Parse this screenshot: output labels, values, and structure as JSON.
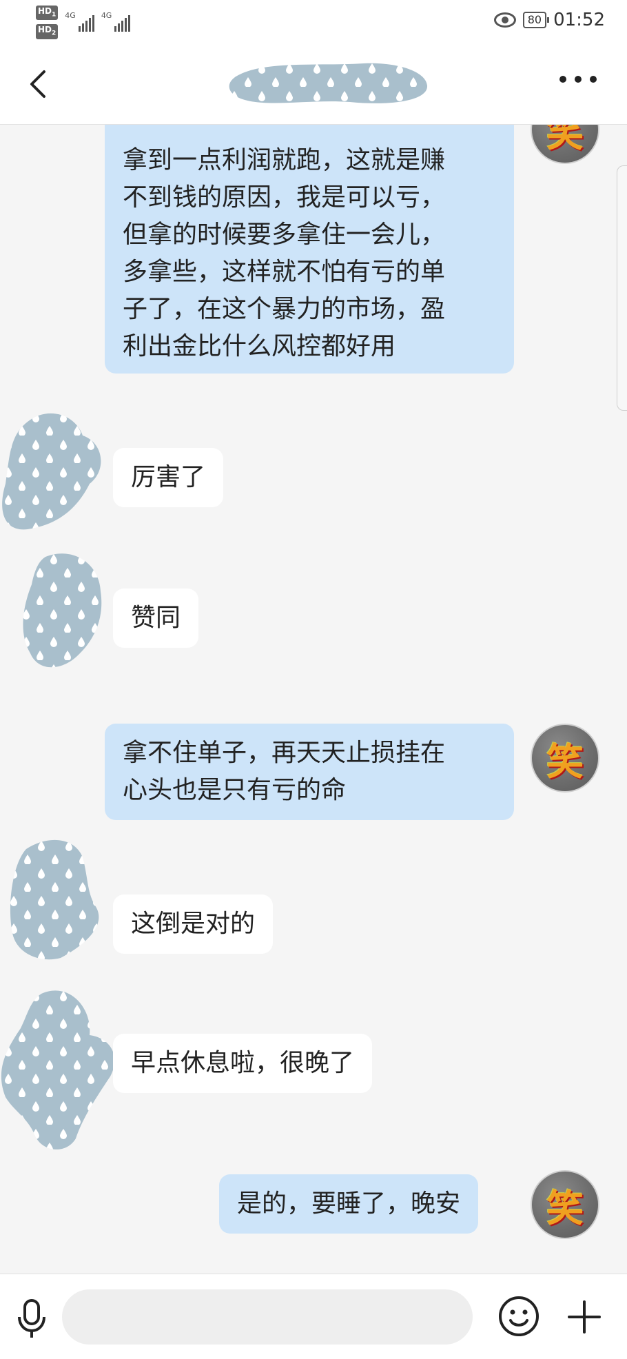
{
  "status_bar": {
    "hd1": "HD",
    "hd1_sub": "1",
    "hd2": "HD",
    "hd2_sub": "2",
    "net1": "4G",
    "net2": "4G",
    "battery": "80",
    "time": "01:52"
  },
  "header": {
    "title": "",
    "title_redacted": true
  },
  "messages": [
    {
      "from": "me",
      "text": "拿到一点利润就跑，这就是赚\n不到钱的原因，我是可以亏，\n但拿的时候要多拿住一会儿，\n多拿些，这样就不怕有亏的单\n子了，在这个暴力的市场，盈\n利出金比什么风控都好用"
    },
    {
      "from": "other",
      "text": "厉害了"
    },
    {
      "from": "other",
      "text": "赞同"
    },
    {
      "from": "me",
      "text": "拿不住单子，再天天止损挂在\n心头也是只有亏的命"
    },
    {
      "from": "other",
      "text": "这倒是对的"
    },
    {
      "from": "other",
      "text": "早点休息啦，很晚了"
    },
    {
      "from": "me",
      "text": "是的，要睡了，晚安"
    }
  ],
  "avatar_me_glyph": "笑",
  "input": {
    "placeholder": "",
    "value": ""
  },
  "icons": {
    "back": "chevron-left-icon",
    "more": "more-dots-icon",
    "mic": "microphone-icon",
    "emoji": "emoji-icon",
    "plus": "plus-icon",
    "eye": "eye-comfort-icon",
    "battery": "battery-icon"
  },
  "colors": {
    "my_bubble": "#cde4f9",
    "their_bubble": "#ffffff",
    "background": "#f5f5f5",
    "redaction": "#a9bfcc"
  }
}
